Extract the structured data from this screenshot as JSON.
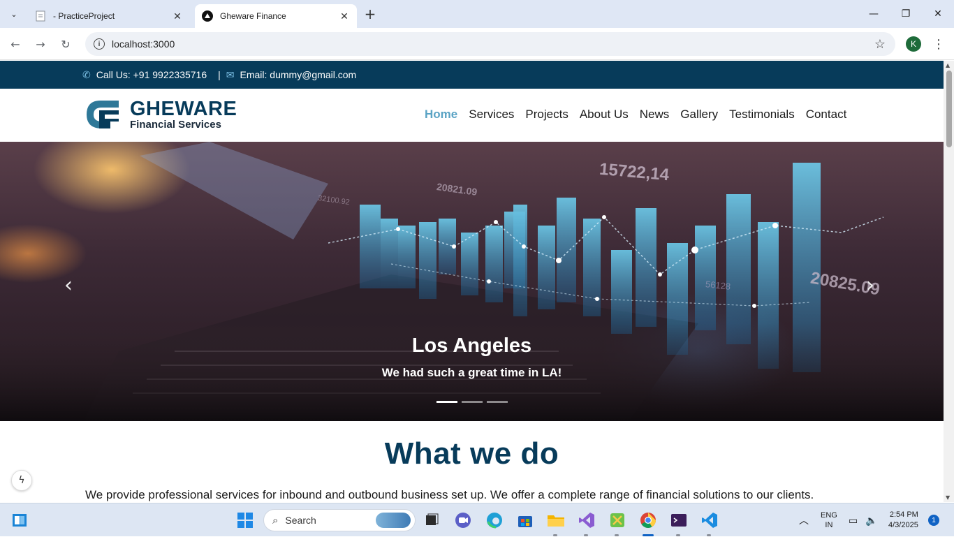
{
  "browser": {
    "tabs": [
      {
        "title": "- PracticeProject",
        "active": false
      },
      {
        "title": "Gheware Finance",
        "active": true
      }
    ],
    "url": "localhost:3000",
    "profile_initial": "K"
  },
  "site": {
    "topbar": {
      "phone": "Call Us: +91 9922335716",
      "separator": "|",
      "email": "Email: dummy@gmail.com"
    },
    "logo": {
      "title": "GHEWARE",
      "subtitle": "Financial Services"
    },
    "nav": [
      {
        "label": "Home",
        "active": true
      },
      {
        "label": "Services",
        "active": false
      },
      {
        "label": "Projects",
        "active": false
      },
      {
        "label": "About Us",
        "active": false
      },
      {
        "label": "News",
        "active": false
      },
      {
        "label": "Gallery",
        "active": false
      },
      {
        "label": "Testimonials",
        "active": false
      },
      {
        "label": "Contact",
        "active": false
      }
    ],
    "hero": {
      "heading": "Los Angeles",
      "text": "We had such a great time in LA!",
      "slide_count": 3,
      "active_slide": 1,
      "overlay_numbers": [
        "15722,14",
        "20821.09",
        "32100.92",
        "20825.09",
        "56128"
      ]
    },
    "what_we_do": {
      "heading": "What we do",
      "text": "We provide professional services for inbound and outbound business set up. We offer a complete range of financial solutions to our clients."
    },
    "colors": {
      "primary": "#073b5a",
      "accent": "#5aa3c4"
    }
  },
  "taskbar": {
    "search_placeholder": "Search",
    "lang_line1": "ENG",
    "lang_line2": "IN",
    "time": "2:54 PM",
    "date": "4/3/2025",
    "notification_count": "1"
  }
}
